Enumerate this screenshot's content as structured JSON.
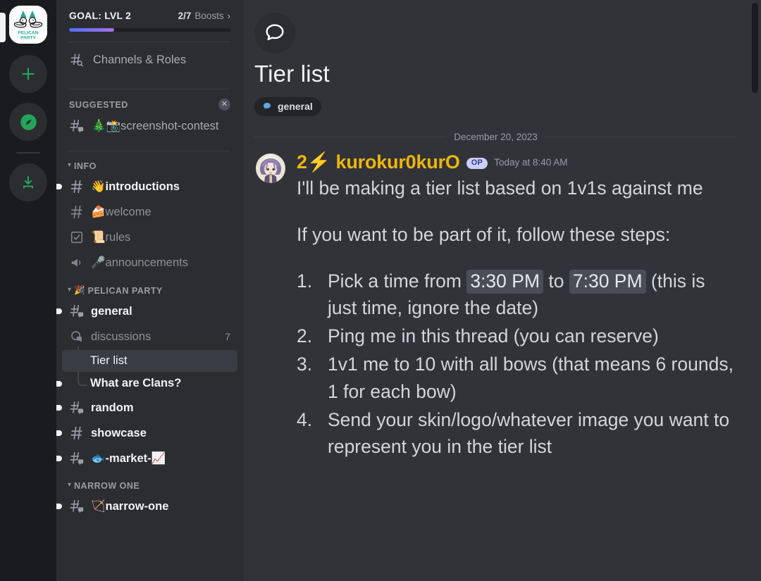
{
  "server_rail": {
    "active_server": {
      "name": "PELICAN PARTY",
      "logo_line1": "PELICAN",
      "logo_line2": "PARTY"
    },
    "buttons": [
      {
        "name": "add-server",
        "icon": "plus-icon"
      },
      {
        "name": "explore-servers",
        "icon": "compass-icon"
      },
      {
        "name": "download-apps",
        "icon": "download-icon"
      }
    ],
    "accent_green": "#23a55a"
  },
  "sidebar": {
    "boost": {
      "goal_label": "GOAL: LVL 2",
      "count": "2/7",
      "unit": "Boosts",
      "chevron": "›",
      "progress_percent": 28,
      "gradient_from": "#4e6ff5",
      "gradient_to": "#a96fe8"
    },
    "channels_and_roles": {
      "label": "Channels & Roles",
      "icon": "hash-search-icon"
    },
    "suggested": {
      "title": "SUGGESTED",
      "close_icon": "✕",
      "items": [
        {
          "label": "🎄📸screenshot-contest",
          "icon": "hash-thread-icon"
        }
      ]
    },
    "categories": [
      {
        "label": "INFO",
        "emoji": "",
        "collapsed": false,
        "channels": [
          {
            "name": "👋introductions",
            "icon": "hash-icon",
            "unread": true,
            "badge": ""
          },
          {
            "name": "🍰welcome",
            "icon": "hash-icon",
            "unread": false,
            "badge": ""
          },
          {
            "name": "📜rules",
            "icon": "rules-icon",
            "unread": false,
            "badge": ""
          },
          {
            "name": "🎤announcements",
            "icon": "announcement-icon",
            "unread": false,
            "badge": ""
          }
        ]
      },
      {
        "label": "PELICAN PARTY",
        "emoji": "🎉",
        "collapsed": false,
        "channels": [
          {
            "name": "general",
            "icon": "hash-thread-icon",
            "unread": true,
            "badge": ""
          },
          {
            "name": "discussions",
            "icon": "forum-icon",
            "unread": false,
            "badge": "7"
          }
        ],
        "threads": [
          {
            "name": "Tier list",
            "active": true,
            "unread": false
          },
          {
            "name": "What are Clans?",
            "active": false,
            "unread": true
          }
        ],
        "channels_after": [
          {
            "name": "random",
            "icon": "hash-thread-icon",
            "unread": true,
            "badge": ""
          },
          {
            "name": "showcase",
            "icon": "hash-icon",
            "unread": true,
            "badge": ""
          },
          {
            "name": "🐟-market-📈",
            "icon": "hash-thread-icon",
            "unread": true,
            "badge": ""
          }
        ]
      },
      {
        "label": "NARROW ONE",
        "emoji": "",
        "collapsed": false,
        "channels": [
          {
            "name": "🏹narrow-one",
            "icon": "hash-thread-icon",
            "unread": true,
            "badge": ""
          }
        ]
      }
    ]
  },
  "main": {
    "thread_icon": "speech-bubble-icon",
    "title": "Tier list",
    "parent_tag": {
      "label": "general",
      "icon": "blue-speech-bubble-icon",
      "icon_color": "#5aa9e6"
    },
    "date_separator": "December 20, 2023",
    "message": {
      "author": "2⚡ kurokur0kurO",
      "author_color": "#eeb60a",
      "badge": "OP",
      "timestamp": "Today at 8:40 AM",
      "paragraphs": [
        "I'll be making a tier list based on 1v1s against me",
        "If you want to be part of it, follow these steps:"
      ],
      "steps": [
        {
          "prefix": "Pick a time from ",
          "mention1": "3:30 PM",
          "middle": " to ",
          "mention2": "7:30 PM",
          "suffix": " (this is just time, ignore the date)"
        },
        {
          "text": "Ping me in this thread (you can reserve)"
        },
        {
          "text": "1v1 me to 10 with all bows (that means 6 rounds, 1 for each bow)"
        },
        {
          "text": "Send your skin/logo/whatever image you want to represent you in the tier list"
        }
      ]
    }
  }
}
